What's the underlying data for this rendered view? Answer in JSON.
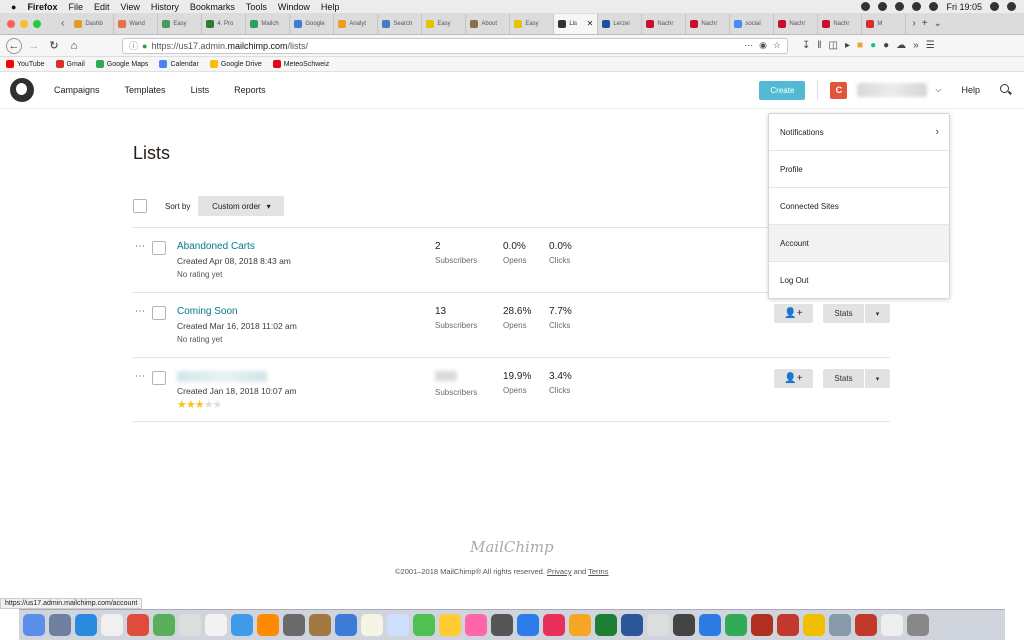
{
  "menubar": {
    "apple": "",
    "app": "Firefox",
    "items": [
      "File",
      "Edit",
      "View",
      "History",
      "Bookmarks",
      "Tools",
      "Window",
      "Help"
    ],
    "clock": "Fri 19:05"
  },
  "tabs": [
    {
      "label": "Dashb",
      "color": "#e59b2a"
    },
    {
      "label": "Wand",
      "color": "#e8704a"
    },
    {
      "label": "Easy",
      "color": "#4c9a5b"
    },
    {
      "label": "4. Pro",
      "color": "#2e7d32"
    },
    {
      "label": "Mailch",
      "color": "#2e9e5b"
    },
    {
      "label": "Google",
      "color": "#3d7bd8"
    },
    {
      "label": "Analyt",
      "color": "#f29b1e"
    },
    {
      "label": "Search",
      "color": "#4a78c2"
    },
    {
      "label": "Easy",
      "color": "#e0c400"
    },
    {
      "label": "About",
      "color": "#8a6d4a"
    },
    {
      "label": "Easy",
      "color": "#e0c400"
    },
    {
      "label": "Lis",
      "color": "#333333",
      "active": true
    },
    {
      "label": "Lerzei",
      "color": "#1e4fa0"
    },
    {
      "label": "Nachr",
      "color": "#c8102e"
    },
    {
      "label": "Nachr",
      "color": "#c8102e"
    },
    {
      "label": "social",
      "color": "#4a8df0"
    },
    {
      "label": "Nachr",
      "color": "#c8102e"
    },
    {
      "label": "Nachr",
      "color": "#c8102e"
    },
    {
      "label": "M",
      "color": "#d32f2f"
    }
  ],
  "url": "https://us17.admin.mailchimp.com/lists/",
  "url_parts": {
    "prefix": "https://us17.admin.",
    "domain": "mailchimp.com",
    "path": "/lists/"
  },
  "bookmarks": [
    {
      "label": "YouTube",
      "color": "#ff0000"
    },
    {
      "label": "Gmail",
      "color": "#d93025"
    },
    {
      "label": "Google Maps",
      "color": "#34a853"
    },
    {
      "label": "Calendar",
      "color": "#4285f4"
    },
    {
      "label": "Google Drive",
      "color": "#fbbc04"
    },
    {
      "label": "MeteoSchweiz",
      "color": "#e30613"
    }
  ],
  "header": {
    "nav": [
      "Campaigns",
      "Templates",
      "Lists",
      "Reports"
    ],
    "create": "Create",
    "avatar_letter": "C",
    "help": "Help"
  },
  "page": {
    "title": "Lists",
    "sort_by": "Sort by",
    "sort_value": "Custom order"
  },
  "lists": [
    {
      "name": "Abandoned Carts",
      "created": "Created Apr 08, 2018 8:43 am",
      "rating": "No rating yet",
      "subscribers": "2",
      "opens": "0.0%",
      "clicks": "0.0%",
      "stars": 0,
      "blurred": false
    },
    {
      "name": "Coming Soon",
      "created": "Created Mar 16, 2018 11:02 am",
      "rating": "No rating yet",
      "subscribers": "13",
      "opens": "28.6%",
      "clicks": "7.7%",
      "stars": 0,
      "blurred": false
    },
    {
      "name": "",
      "created": "Created Jan 18, 2018 10:07 am",
      "rating": "",
      "subscribers": "",
      "opens": "19.9%",
      "clicks": "3.4%",
      "stars": 3,
      "blurred": true
    }
  ],
  "labels": {
    "subscribers": "Subscribers",
    "opens": "Opens",
    "clicks": "Clicks",
    "stats": "Stats"
  },
  "account_menu": [
    "Notifications",
    "Profile",
    "Connected Sites",
    "Account",
    "Log Out"
  ],
  "footer": {
    "logo": "MailChimp",
    "copyright": "©2001–2018 MailChimp® All rights reserved.",
    "privacy": "Privacy",
    "and": "and",
    "terms": "Terms"
  },
  "status_url": "https://us17.admin.mailchimp.com/account",
  "dock_colors": [
    "#5a8ee8",
    "#6f7fa0",
    "#2a8ae0",
    "#f0f0f0",
    "#e04c3c",
    "#5ab05a",
    "#ddd",
    "#f2f2f2",
    "#3d9be9",
    "#ff8a00",
    "#6a6a6a",
    "#a07840",
    "#3d7bd8",
    "#f5f5e5",
    "#cfe0ff",
    "#50c050",
    "#ffcc33",
    "#f6a",
    "#555",
    "#2b7de9",
    "#e8305a",
    "#f6a623",
    "#1e7e34",
    "#2b579a",
    "#ddd",
    "#444",
    "#2c7ce4",
    "#33aa55",
    "#b03020",
    "#c0392b",
    "#f0c000",
    "#8899aa",
    "#c0392b",
    "#eee",
    "#888"
  ]
}
